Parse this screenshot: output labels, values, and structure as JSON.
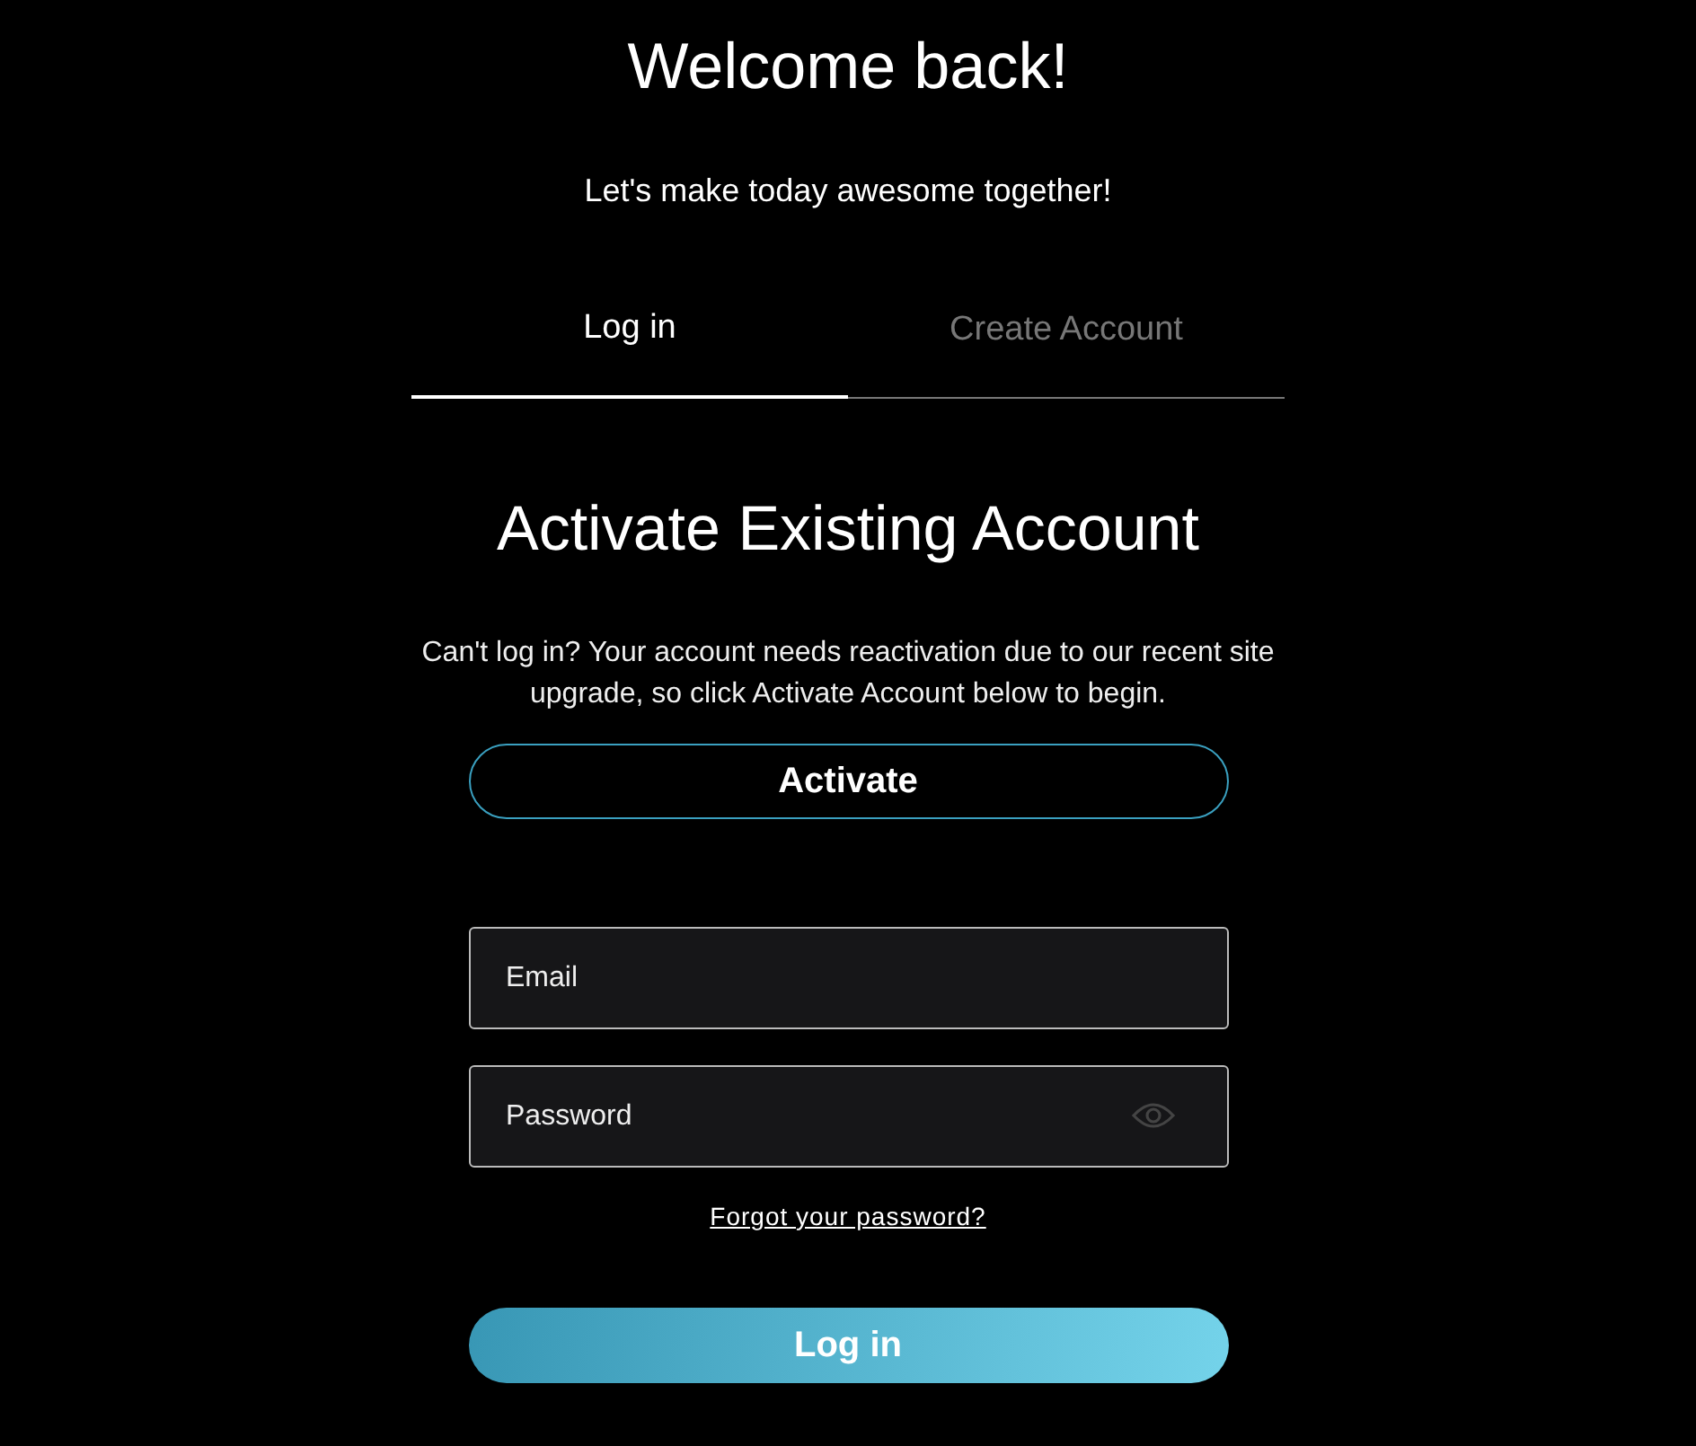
{
  "title": "Welcome back!",
  "subtitle": "Let's make today awesome together!",
  "tabs": [
    {
      "label": "Log in",
      "selected": true
    },
    {
      "label": "Create Account",
      "selected": false
    }
  ],
  "heading": "Activate Existing Account",
  "notice": "Can't log in? Your account needs reactivation due to our recent site upgrade, so click Activate Account below to begin.",
  "activate_button": "Activate",
  "fields": [
    {
      "placeholder": "Email",
      "kind": "text"
    },
    {
      "placeholder": "Password",
      "kind": "password"
    }
  ],
  "forgot_link": "Forgot your password?",
  "login_button": "Log in"
}
